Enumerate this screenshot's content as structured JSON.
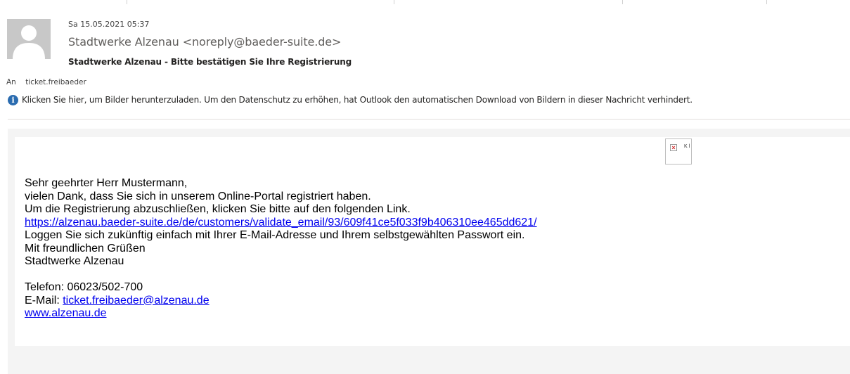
{
  "email": {
    "date": "Sa 15.05.2021 05:37",
    "sender": "Stadtwerke Alzenau <noreply@baeder-suite.de>",
    "subject": "Stadtwerke Alzenau - Bitte bestätigen Sie Ihre Registrierung",
    "to_label": "An",
    "to_value": "ticket.freibaeder",
    "info_bar": "Klicken Sie hier, um Bilder herunterzuladen. Um den Datenschutz zu erhöhen, hat Outlook den automatischen Download von Bildern in dieser Nachricht verhindert.",
    "broken_image_alt": "K l"
  },
  "body": {
    "greeting": "Sehr geehrter Herr Mustermann,",
    "line1": "vielen Dank, dass Sie sich in unserem Online-Portal registriert haben.",
    "line2": "Um die Registrierung abzuschließen, klicken Sie bitte auf den folgenden Link.",
    "link": "https://alzenau.baeder-suite.de/de/customers/validate_email/93/609f41ce5f033f9b406310ee465dd621/",
    "line3": "Loggen Sie sich zukünftig einfach mit Ihrer E-Mail-Adresse und Ihrem selbstgewählten Passwort ein.",
    "closing": "Mit freundlichen Grüßen",
    "signature": "Stadtwerke Alzenau",
    "phone": "Telefon: 06023/502-700",
    "email_label": "E-Mail: ",
    "email_link": "ticket.freibaeder@alzenau.de",
    "website": "www.alzenau.de"
  },
  "icons": {
    "avatar": "person-silhouette-icon",
    "info": "info-icon",
    "broken_image": "broken-image-icon"
  },
  "colors": {
    "link": "#0000ee",
    "info_icon": "#2b6cb0",
    "avatar_bg": "#c8c8c8"
  }
}
